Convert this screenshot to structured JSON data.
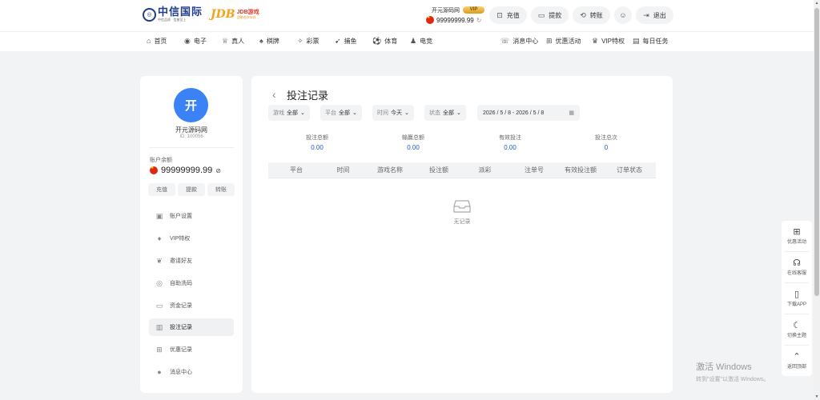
{
  "logo": {
    "title": "中信国际",
    "sub": "中信品质 · 信誉至上"
  },
  "partner": {
    "mark": "JDB",
    "title": "JDB游戏",
    "sub": "战略合作伙伴"
  },
  "user": {
    "name": "开元源码网",
    "vip": "VIP",
    "balance": "99999999.99"
  },
  "top_buttons": {
    "deposit": "充值",
    "withdraw": "提款",
    "transfer": "转账",
    "logout": "退出"
  },
  "nav": {
    "left": [
      "首页",
      "电子",
      "真人",
      "棋牌",
      "彩票",
      "捕鱼",
      "体育",
      "电竞"
    ],
    "right": [
      "消息中心",
      "优惠活动",
      "VIP特权",
      "每日任务"
    ]
  },
  "sidebar": {
    "avatar_char": "开",
    "name": "开元源码网",
    "id": "ID: 100056",
    "balance_label": "账户余额",
    "balance": "99999999.99",
    "buttons": [
      "充值",
      "提款",
      "转账"
    ],
    "menu": [
      "账户设置",
      "VIP特权",
      "邀请好友",
      "自助洗码",
      "资金记录",
      "投注记录",
      "优惠记录",
      "消息中心"
    ]
  },
  "main": {
    "back": "‹",
    "title": "投注记录",
    "filters": [
      {
        "label": "游戏",
        "value": "全部"
      },
      {
        "label": "平台",
        "value": "全部"
      },
      {
        "label": "时间",
        "value": "今天"
      },
      {
        "label": "状态",
        "value": "全部"
      }
    ],
    "date_range": "2026 / 5 / 8 - 2026 / 5 / 8",
    "stats": [
      {
        "label": "投注总额",
        "value": "0.00"
      },
      {
        "label": "输赢总额",
        "value": "0.00"
      },
      {
        "label": "有效投注",
        "value": "0.00"
      },
      {
        "label": "投注总次",
        "value": "0"
      }
    ],
    "columns": [
      "平台",
      "时间",
      "游戏名称",
      "投注额",
      "派彩",
      "注单号",
      "有效投注额",
      "订单状态"
    ],
    "empty": "无记录"
  },
  "float_bar": [
    "优惠活动",
    "在线客服",
    "下载APP",
    "切换主题",
    "返回顶部"
  ],
  "watermark": {
    "line1": "激活 Windows",
    "line2": "转到\"设置\"以激活 Windows。"
  }
}
